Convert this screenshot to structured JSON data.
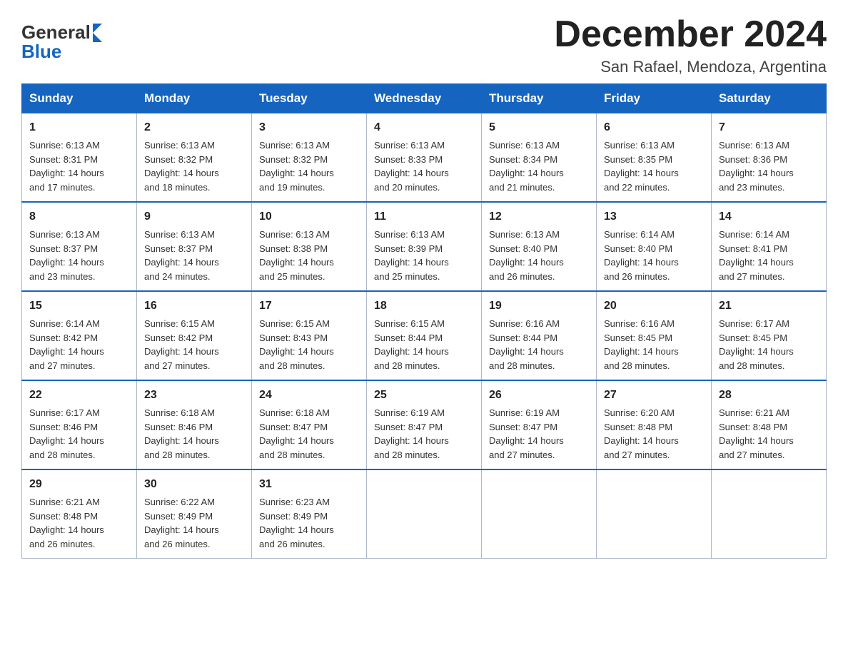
{
  "header": {
    "logo_general": "General",
    "logo_blue": "Blue",
    "title": "December 2024",
    "location": "San Rafael, Mendoza, Argentina"
  },
  "weekdays": [
    "Sunday",
    "Monday",
    "Tuesday",
    "Wednesday",
    "Thursday",
    "Friday",
    "Saturday"
  ],
  "weeks": [
    [
      {
        "day": "1",
        "sunrise": "6:13 AM",
        "sunset": "8:31 PM",
        "daylight": "14 hours and 17 minutes."
      },
      {
        "day": "2",
        "sunrise": "6:13 AM",
        "sunset": "8:32 PM",
        "daylight": "14 hours and 18 minutes."
      },
      {
        "day": "3",
        "sunrise": "6:13 AM",
        "sunset": "8:32 PM",
        "daylight": "14 hours and 19 minutes."
      },
      {
        "day": "4",
        "sunrise": "6:13 AM",
        "sunset": "8:33 PM",
        "daylight": "14 hours and 20 minutes."
      },
      {
        "day": "5",
        "sunrise": "6:13 AM",
        "sunset": "8:34 PM",
        "daylight": "14 hours and 21 minutes."
      },
      {
        "day": "6",
        "sunrise": "6:13 AM",
        "sunset": "8:35 PM",
        "daylight": "14 hours and 22 minutes."
      },
      {
        "day": "7",
        "sunrise": "6:13 AM",
        "sunset": "8:36 PM",
        "daylight": "14 hours and 23 minutes."
      }
    ],
    [
      {
        "day": "8",
        "sunrise": "6:13 AM",
        "sunset": "8:37 PM",
        "daylight": "14 hours and 23 minutes."
      },
      {
        "day": "9",
        "sunrise": "6:13 AM",
        "sunset": "8:37 PM",
        "daylight": "14 hours and 24 minutes."
      },
      {
        "day": "10",
        "sunrise": "6:13 AM",
        "sunset": "8:38 PM",
        "daylight": "14 hours and 25 minutes."
      },
      {
        "day": "11",
        "sunrise": "6:13 AM",
        "sunset": "8:39 PM",
        "daylight": "14 hours and 25 minutes."
      },
      {
        "day": "12",
        "sunrise": "6:13 AM",
        "sunset": "8:40 PM",
        "daylight": "14 hours and 26 minutes."
      },
      {
        "day": "13",
        "sunrise": "6:14 AM",
        "sunset": "8:40 PM",
        "daylight": "14 hours and 26 minutes."
      },
      {
        "day": "14",
        "sunrise": "6:14 AM",
        "sunset": "8:41 PM",
        "daylight": "14 hours and 27 minutes."
      }
    ],
    [
      {
        "day": "15",
        "sunrise": "6:14 AM",
        "sunset": "8:42 PM",
        "daylight": "14 hours and 27 minutes."
      },
      {
        "day": "16",
        "sunrise": "6:15 AM",
        "sunset": "8:42 PM",
        "daylight": "14 hours and 27 minutes."
      },
      {
        "day": "17",
        "sunrise": "6:15 AM",
        "sunset": "8:43 PM",
        "daylight": "14 hours and 28 minutes."
      },
      {
        "day": "18",
        "sunrise": "6:15 AM",
        "sunset": "8:44 PM",
        "daylight": "14 hours and 28 minutes."
      },
      {
        "day": "19",
        "sunrise": "6:16 AM",
        "sunset": "8:44 PM",
        "daylight": "14 hours and 28 minutes."
      },
      {
        "day": "20",
        "sunrise": "6:16 AM",
        "sunset": "8:45 PM",
        "daylight": "14 hours and 28 minutes."
      },
      {
        "day": "21",
        "sunrise": "6:17 AM",
        "sunset": "8:45 PM",
        "daylight": "14 hours and 28 minutes."
      }
    ],
    [
      {
        "day": "22",
        "sunrise": "6:17 AM",
        "sunset": "8:46 PM",
        "daylight": "14 hours and 28 minutes."
      },
      {
        "day": "23",
        "sunrise": "6:18 AM",
        "sunset": "8:46 PM",
        "daylight": "14 hours and 28 minutes."
      },
      {
        "day": "24",
        "sunrise": "6:18 AM",
        "sunset": "8:47 PM",
        "daylight": "14 hours and 28 minutes."
      },
      {
        "day": "25",
        "sunrise": "6:19 AM",
        "sunset": "8:47 PM",
        "daylight": "14 hours and 28 minutes."
      },
      {
        "day": "26",
        "sunrise": "6:19 AM",
        "sunset": "8:47 PM",
        "daylight": "14 hours and 27 minutes."
      },
      {
        "day": "27",
        "sunrise": "6:20 AM",
        "sunset": "8:48 PM",
        "daylight": "14 hours and 27 minutes."
      },
      {
        "day": "28",
        "sunrise": "6:21 AM",
        "sunset": "8:48 PM",
        "daylight": "14 hours and 27 minutes."
      }
    ],
    [
      {
        "day": "29",
        "sunrise": "6:21 AM",
        "sunset": "8:48 PM",
        "daylight": "14 hours and 26 minutes."
      },
      {
        "day": "30",
        "sunrise": "6:22 AM",
        "sunset": "8:49 PM",
        "daylight": "14 hours and 26 minutes."
      },
      {
        "day": "31",
        "sunrise": "6:23 AM",
        "sunset": "8:49 PM",
        "daylight": "14 hours and 26 minutes."
      },
      null,
      null,
      null,
      null
    ]
  ],
  "labels": {
    "sunrise": "Sunrise:",
    "sunset": "Sunset:",
    "daylight": "Daylight:"
  }
}
